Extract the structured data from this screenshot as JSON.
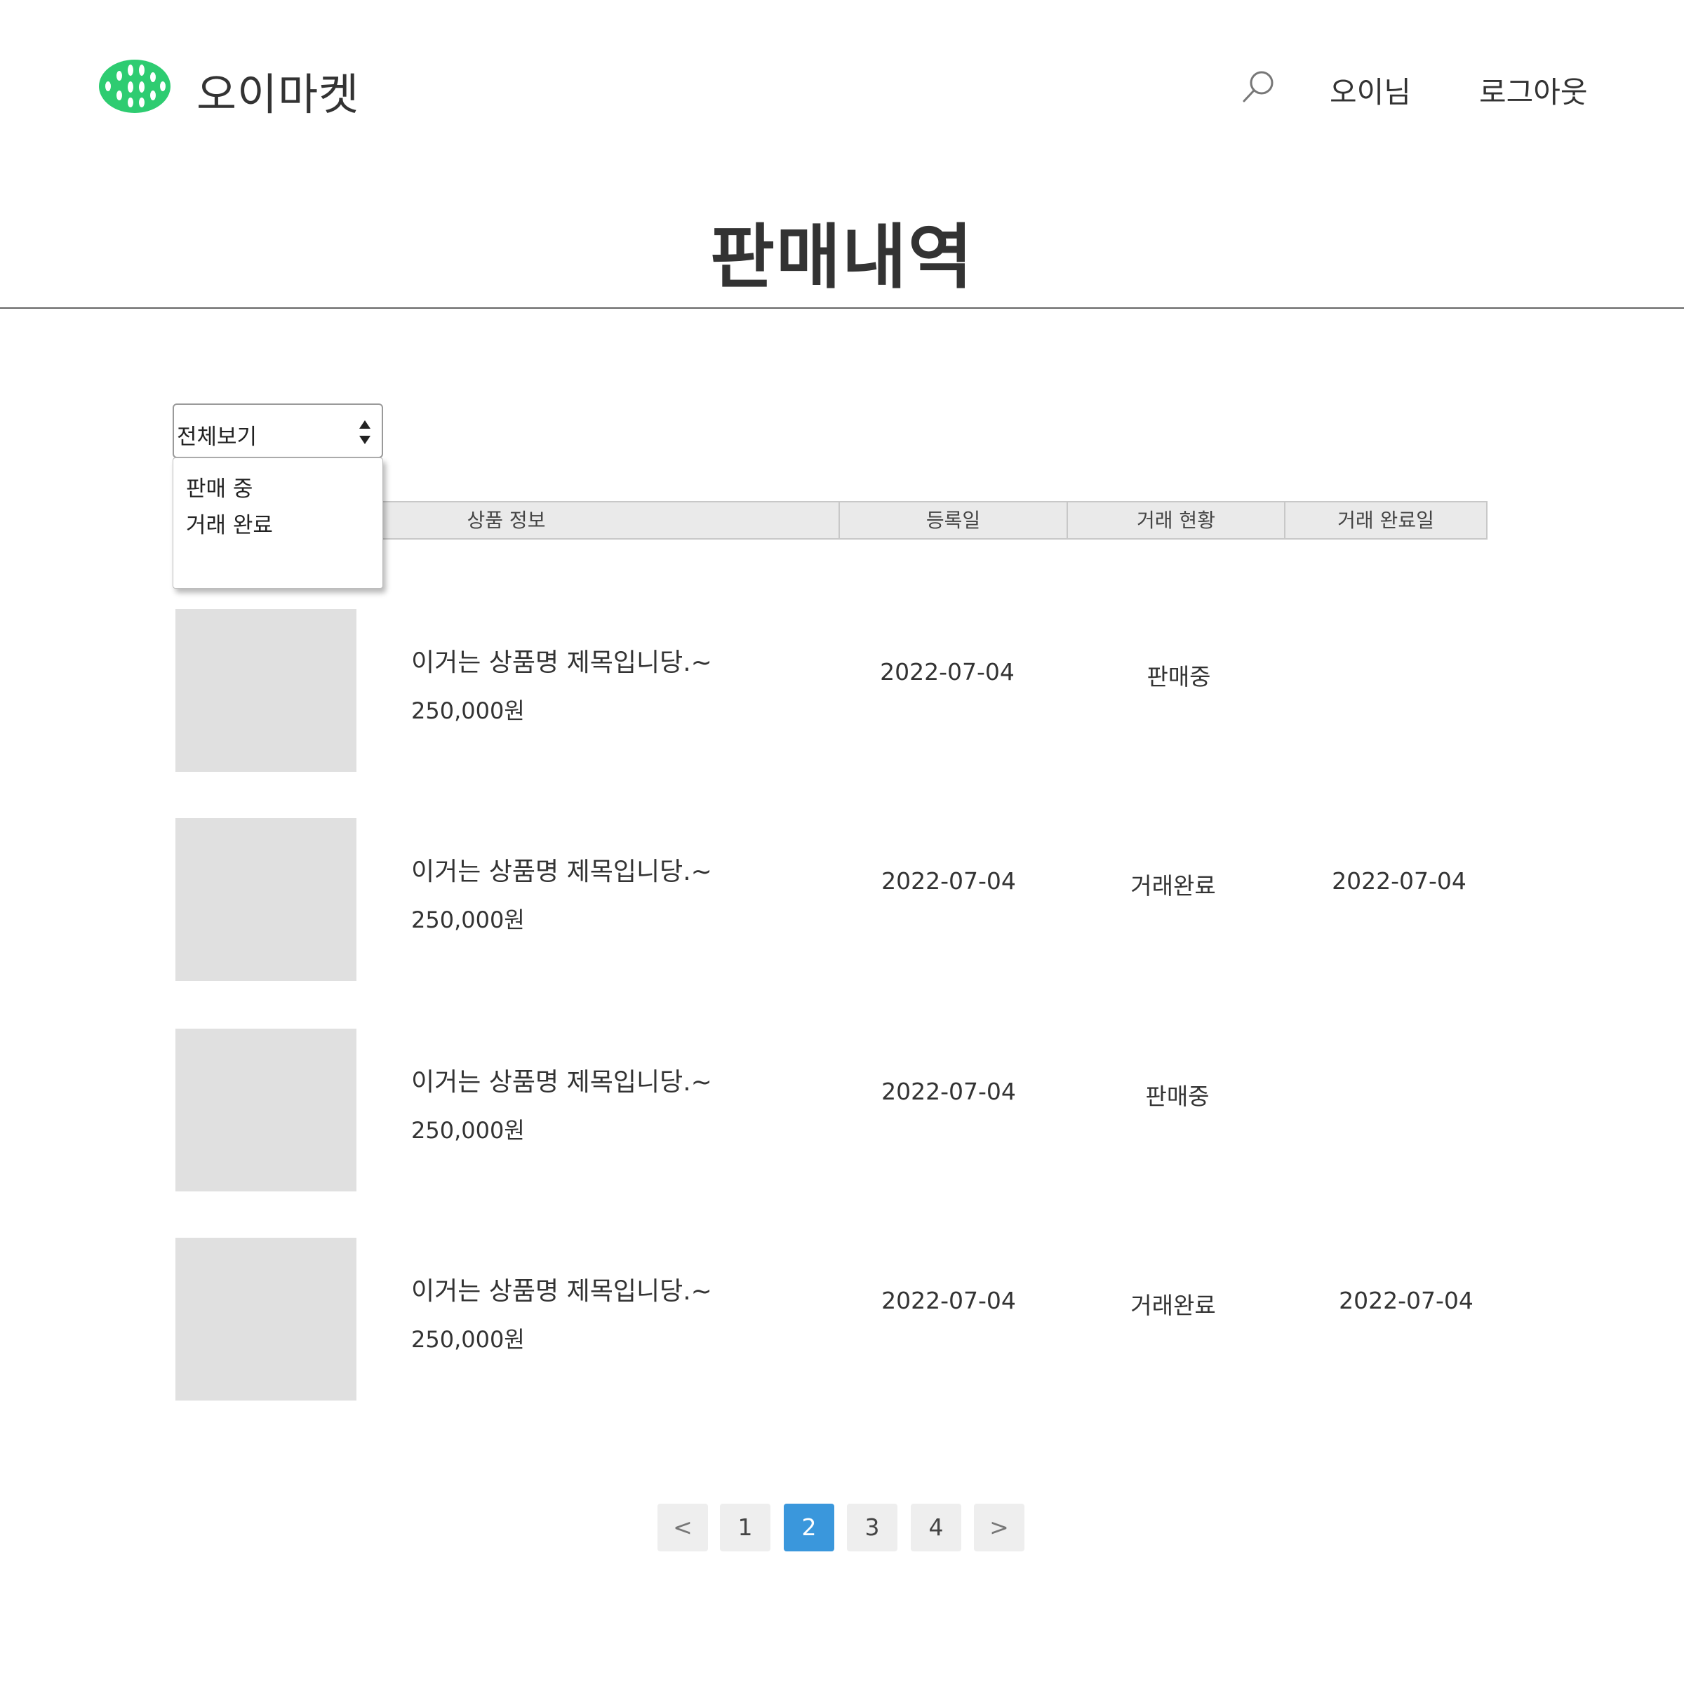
{
  "header": {
    "brand": "오이마켓",
    "user_label": "오이님",
    "logout_label": "로그아웃",
    "accent_color": "#2ecc71"
  },
  "page_title": "판매내역",
  "filter": {
    "selected": "전체보기",
    "options": [
      "판매 중",
      "거래 완료"
    ]
  },
  "table": {
    "columns": [
      "상품 정보",
      "등록일",
      "거래 현황",
      "거래 완료일"
    ],
    "rows": [
      {
        "name": "이거는 상품명 제목입니당.~",
        "price": "250,000원",
        "registered": "2022-07-04",
        "status": "판매중",
        "completed": ""
      },
      {
        "name": "이거는 상품명 제목입니당.~",
        "price": "250,000원",
        "registered": "2022-07-04",
        "status": "거래완료",
        "completed": "2022-07-04"
      },
      {
        "name": "이거는 상품명 제목입니당.~",
        "price": "250,000원",
        "registered": "2022-07-04",
        "status": "판매중",
        "completed": ""
      },
      {
        "name": "이거는 상품명 제목입니당.~",
        "price": "250,000원",
        "registered": "2022-07-04",
        "status": "거래완료",
        "completed": "2022-07-04"
      }
    ]
  },
  "pagination": {
    "prev_label": "<",
    "next_label": ">",
    "pages": [
      "1",
      "2",
      "3",
      "4"
    ],
    "current": "2",
    "active_color": "#3a97dc"
  }
}
